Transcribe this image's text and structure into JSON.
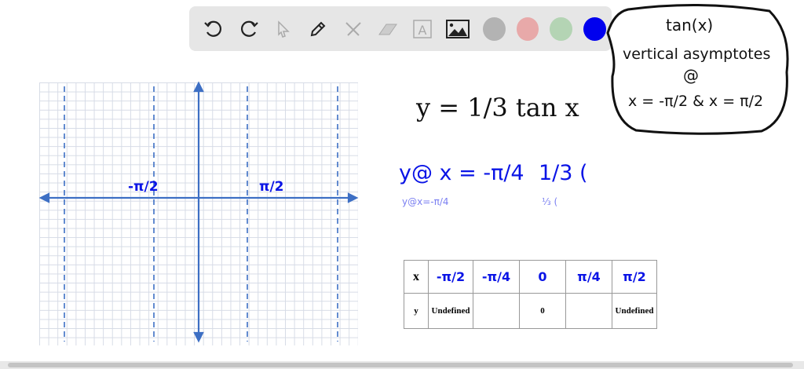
{
  "toolbar": {
    "tools": [
      "undo-icon",
      "redo-icon",
      "select-icon",
      "pen-icon",
      "tools-icon",
      "eraser-icon",
      "text-icon",
      "image-icon"
    ],
    "colors": [
      "#b3b3b3",
      "#e8a9a9",
      "#b4d4b4",
      "#0000ee"
    ]
  },
  "graph": {
    "label_left": "-π/2",
    "label_right": "π/2"
  },
  "equation": "y = 1/3 tan x",
  "work": {
    "line1": "y@ x = -π/4",
    "line2": "1/3 (",
    "line1_display": "y@x=-π/4",
    "line2_display": "⅓ ("
  },
  "note": {
    "l1": "tan(x)",
    "l2": "vertical asymptotes",
    "l3": "@",
    "l4": "x = -π/2 & x = π/2"
  },
  "table": {
    "x_label": "x",
    "y_label": "y",
    "x_values": [
      "-π/2",
      "-π/4",
      "0",
      "π/4",
      "π/2"
    ],
    "y_values": [
      "Undefined",
      "",
      "0",
      "",
      "Undefined"
    ]
  }
}
